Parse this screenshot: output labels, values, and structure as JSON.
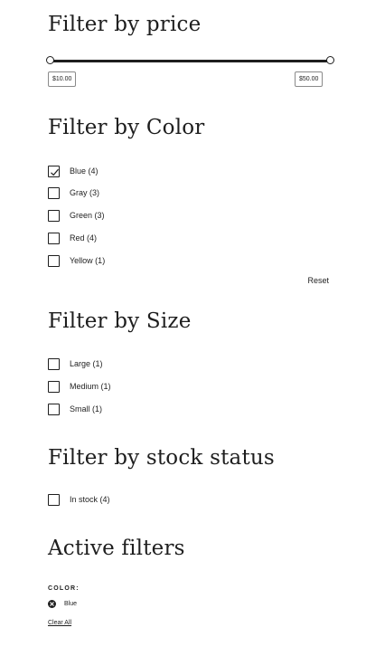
{
  "price": {
    "heading": "Filter by price",
    "min_value": "$10.00",
    "max_value": "$50.00"
  },
  "color": {
    "heading": "Filter by Color",
    "options": [
      {
        "label": "Blue (4)",
        "checked": true
      },
      {
        "label": "Gray (3)",
        "checked": false
      },
      {
        "label": "Green (3)",
        "checked": false
      },
      {
        "label": "Red (4)",
        "checked": false
      },
      {
        "label": "Yellow (1)",
        "checked": false
      }
    ],
    "reset_label": "Reset"
  },
  "size": {
    "heading": "Filter by Size",
    "options": [
      {
        "label": "Large (1)",
        "checked": false
      },
      {
        "label": "Medium (1)",
        "checked": false
      },
      {
        "label": "Small (1)",
        "checked": false
      }
    ]
  },
  "stock": {
    "heading": "Filter by stock status",
    "options": [
      {
        "label": "In stock (4)",
        "checked": false
      }
    ]
  },
  "active": {
    "heading": "Active filters",
    "category": "COLOR:",
    "chip_label": "Blue",
    "clear_all": "Clear All"
  },
  "icons": {
    "check": "checkmark-icon",
    "remove": "remove-circle-icon"
  }
}
